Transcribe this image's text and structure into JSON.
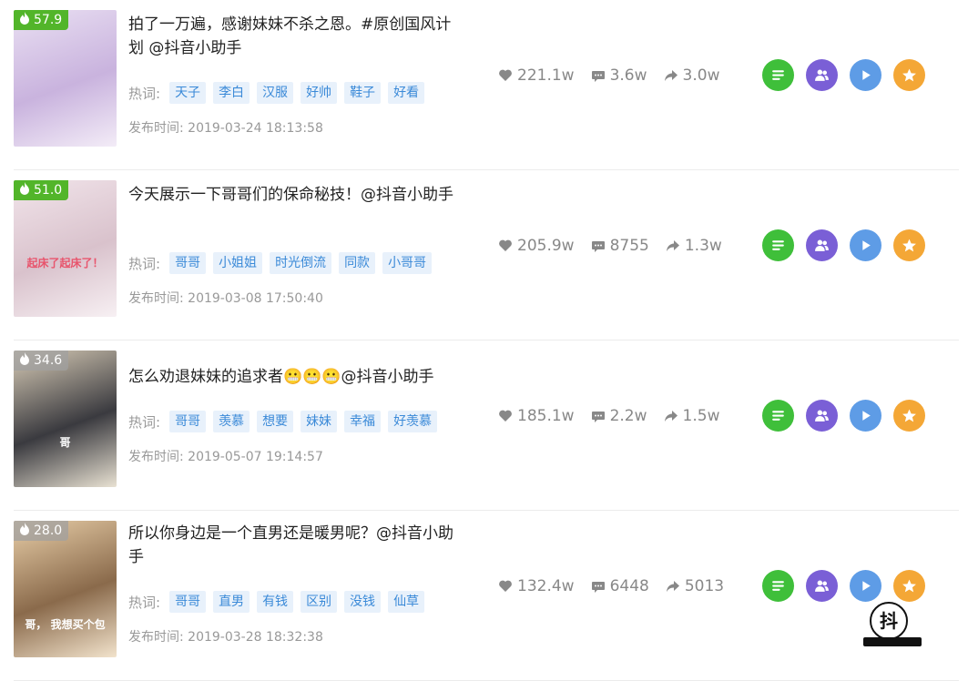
{
  "videos": [
    {
      "heat": "57.9",
      "heat_style": "hot",
      "title": "拍了一万遍，感谢妹妹不杀之恩。#原创国风计划 @抖音小助手",
      "tags_label": "热词:",
      "tags": [
        "天子",
        "李白",
        "汉服",
        "好帅",
        "鞋子",
        "好看"
      ],
      "date": "发布时间:  2019-03-24 18:13:58",
      "likes": "221.1w",
      "comments": "3.6w",
      "shares": "3.0w",
      "thumb_colors": [
        "#e9dff2",
        "#c9b3de",
        "#f3ecf7"
      ],
      "overlay": ""
    },
    {
      "heat": "51.0",
      "heat_style": "hot",
      "title": "今天展示一下哥哥们的保命秘技！@抖音小助手",
      "tags_label": "热词:",
      "tags": [
        "哥哥",
        "小姐姐",
        "时光倒流",
        "同款",
        "小哥哥"
      ],
      "date": "发布时间:  2019-03-08 17:50:40",
      "likes": "205.9w",
      "comments": "8755",
      "shares": "1.3w",
      "thumb_colors": [
        "#f1e4ea",
        "#d9c2cc",
        "#f7f0f3"
      ],
      "overlay": "起床了起床了！"
    },
    {
      "heat": "34.6",
      "heat_style": "cool",
      "title": "怎么劝退妹妹的追求者😬😬😬@抖音小助手",
      "tags_label": "热词:",
      "tags": [
        "哥哥",
        "羡慕",
        "想要",
        "妹妹",
        "幸福",
        "好羡慕"
      ],
      "date": "发布时间:  2019-05-07 19:14:57",
      "likes": "185.1w",
      "comments": "2.2w",
      "shares": "1.5w",
      "thumb_colors": [
        "#d7cbb6",
        "#3a3a3f",
        "#e9e2d3"
      ],
      "overlay": "哥"
    },
    {
      "heat": "28.0",
      "heat_style": "cool",
      "title": "所以你身边是一个直男还是暖男呢？@抖音小助手",
      "tags_label": "热词:",
      "tags": [
        "哥哥",
        "直男",
        "有钱",
        "区别",
        "没钱",
        "仙草"
      ],
      "date": "发布时间:  2019-03-28 18:32:38",
      "likes": "132.4w",
      "comments": "6448",
      "shares": "5013",
      "thumb_colors": [
        "#e7cda7",
        "#8a6a4b",
        "#f2e3cc"
      ],
      "overlay": "哥，  我想买个包"
    }
  ],
  "icons": {
    "heat": "flame-icon",
    "likes": "heart-icon",
    "comments": "comment-icon",
    "shares": "share-arrow-icon",
    "actions": [
      "list-icon",
      "users-icon",
      "play-icon",
      "star-icon"
    ]
  },
  "colors": {
    "heat_hot": "#52b52a",
    "tag_bg": "#e8f1fb",
    "tag_text": "#3b8ad8",
    "action_green": "#3fbf3a",
    "action_purple": "#7a5fd6",
    "action_blue": "#5e9ce6",
    "action_orange": "#f4a736"
  },
  "watermark": {
    "text": "抖"
  }
}
